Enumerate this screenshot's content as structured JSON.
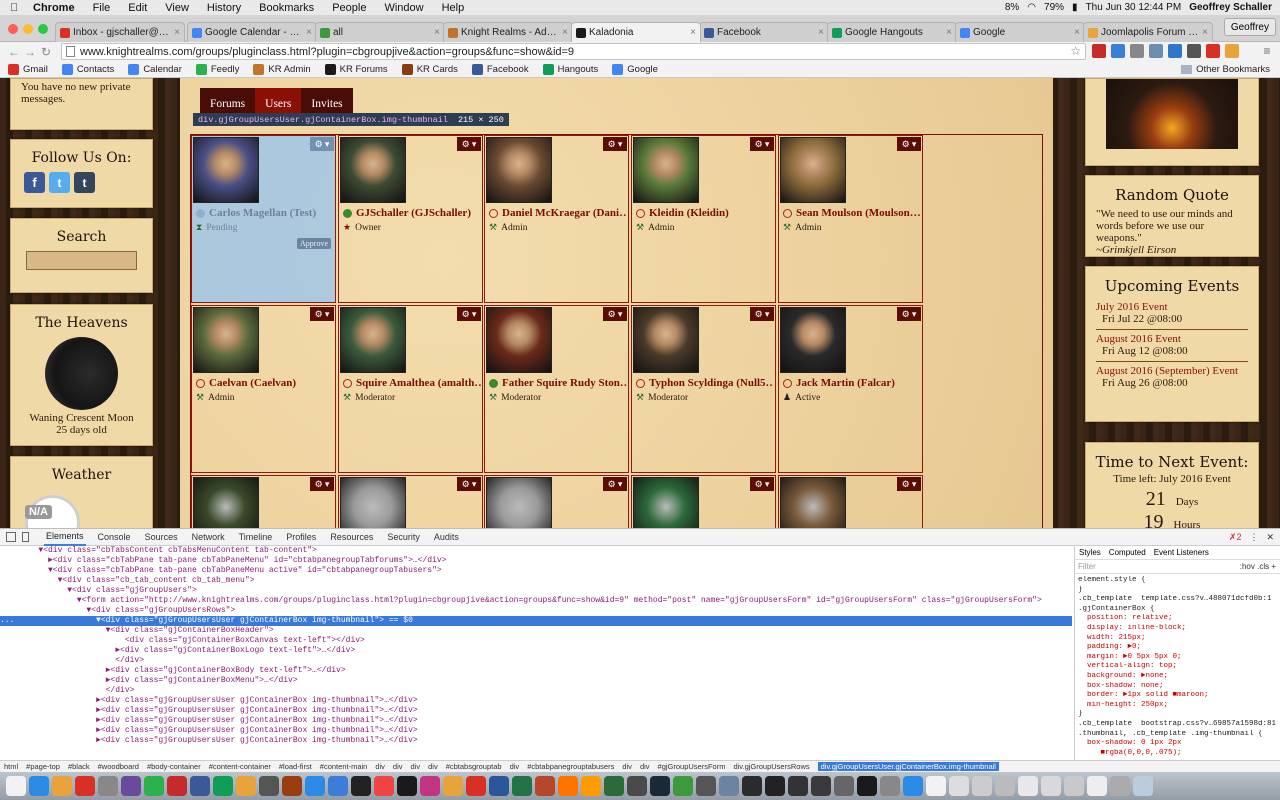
{
  "menubar": {
    "app": "Chrome",
    "items": [
      "File",
      "Edit",
      "View",
      "History",
      "Bookmarks",
      "People",
      "Window",
      "Help"
    ],
    "battery": "79%",
    "volume": "8%",
    "clock": "Thu Jun 30  12:44 PM",
    "user": "Geoffrey Schaller"
  },
  "tabs": [
    {
      "label": "Inbox - gjschaller@gmail.c",
      "color": "#d93025"
    },
    {
      "label": "Google Calendar - Month",
      "color": "#4285f4"
    },
    {
      "label": "all",
      "color": "#3b9a3b"
    },
    {
      "label": "Knight Realms - Administ",
      "color": "#c1732a"
    },
    {
      "label": "Kaladonia",
      "color": "#1a1a1a"
    },
    {
      "label": "Facebook",
      "color": "#3b5998"
    },
    {
      "label": "Google Hangouts",
      "color": "#0f9d58"
    },
    {
      "label": "Google",
      "color": "#4285f4"
    },
    {
      "label": "Joomlapolis Forum - Forum",
      "color": "#e8a33a"
    }
  ],
  "profile_button": "Geoffrey",
  "address": {
    "url": "www.knightrealms.com/groups/pluginclass.html?plugin=cbgroupjive&action=groups&func=show&id=9"
  },
  "bookmarks": [
    {
      "label": "Gmail",
      "color": "#d93025"
    },
    {
      "label": "Contacts",
      "color": "#4285f4"
    },
    {
      "label": "Calendar",
      "color": "#4285f4"
    },
    {
      "label": "Feedly",
      "color": "#2bb24c"
    },
    {
      "label": "KR Admin",
      "color": "#c1732a"
    },
    {
      "label": "KR Forums",
      "color": "#1a1a1a"
    },
    {
      "label": "KR Cards",
      "color": "#8a3b12"
    },
    {
      "label": "Facebook",
      "color": "#3b5998"
    },
    {
      "label": "Hangouts",
      "color": "#0f9d58"
    },
    {
      "label": "Google",
      "color": "#4285f4"
    }
  ],
  "other_bookmarks": "Other Bookmarks",
  "left": {
    "private_msg": "You have no new private messages.",
    "follow_title": "Follow Us On:",
    "search_title": "Search",
    "heavens_title": "The Heavens",
    "moon_phase": "Waning Crescent Moon",
    "moon_age": "25 days old",
    "weather_title": "Weather",
    "weather_badge": "N/A"
  },
  "group_tabs": [
    "Forums",
    "Users",
    "Invites"
  ],
  "tooltip": {
    "selector": "div.gjGroupUsersUser.gjContainerBox.img-thumbnail",
    "dims": "215 × 250"
  },
  "users": [
    {
      "name": "Carlos Magellan (Test)",
      "status": "pend",
      "role": "Pending",
      "role_icon": "hourglass-icon",
      "approve": "Approve",
      "avatar": "#4a4f86"
    },
    {
      "name": "GJSchaller (GJSchaller)",
      "status": "on",
      "role": "Owner",
      "role_icon": "star-icon",
      "avatar": "#3e4b33"
    },
    {
      "name": "Daniel McKraegar (Dani…",
      "status": "off",
      "role": "Admin",
      "role_icon": "hammer-icon",
      "avatar": "#6a4a33"
    },
    {
      "name": "Kleidin (Kleidin)",
      "status": "off",
      "role": "Admin",
      "role_icon": "hammer-icon",
      "avatar": "#5a7a3a"
    },
    {
      "name": "Sean Moulson (Moulson…",
      "status": "off",
      "role": "Admin",
      "role_icon": "hammer-icon",
      "avatar": "#8a6a3a"
    },
    {
      "name": "Caelvan (Caelvan)",
      "status": "off",
      "role": "Admin",
      "role_icon": "hammer-icon",
      "avatar": "#5b6a3c"
    },
    {
      "name": "Squire Amalthea (amalth…",
      "status": "off",
      "role": "Moderator",
      "role_icon": "hammer-icon",
      "avatar": "#3c5a3c"
    },
    {
      "name": "Father Squire Rudy Ston…",
      "status": "on",
      "role": "Moderator",
      "role_icon": "hammer-icon",
      "avatar": "#6a2a1a"
    },
    {
      "name": "Typhon Scyldinga (Null5…",
      "status": "off",
      "role": "Moderator",
      "role_icon": "hammer-icon",
      "avatar": "#4a3a2a"
    },
    {
      "name": "Jack Martin (Falcar)",
      "status": "off",
      "role": "Active",
      "role_icon": "user-icon",
      "avatar": "#2a2a2a"
    }
  ],
  "right": {
    "quote_title": "Random Quote",
    "quote_text": "\"We need to use our minds and words before we use our weapons.\"",
    "quote_author": "~Grimkjell Eirson",
    "events_title": "Upcoming Events",
    "events": [
      {
        "name": "July 2016 Event",
        "date": "Fri Jul 22 @08:00"
      },
      {
        "name": "August 2016 Event",
        "date": "Fri Aug 12 @08:00"
      },
      {
        "name": "August 2016 (September) Event",
        "date": "Fri Aug 26 @08:00"
      }
    ],
    "next_title": "Time to Next Event:",
    "time_left": "Time left: July 2016 Event",
    "days_num": "21",
    "days_label": "Days",
    "hours_num": "19",
    "hours_label": "Hours"
  },
  "devtools": {
    "tabs": [
      "Elements",
      "Console",
      "Sources",
      "Network",
      "Timeline",
      "Profiles",
      "Resources",
      "Security",
      "Audits"
    ],
    "errors": "2",
    "lines": [
      "        ▼<div class=\"cbTabsContent cbTabsMenuContent tab-content\">",
      "          ►<div class=\"cbTabPane tab-pane cbTabPaneMenu\" id=\"cbtabpanegroupTabforums\">…</div>",
      "          ▼<div class=\"cbTabPane tab-pane cbTabPaneMenu active\" id=\"cbtabpanegroupTabusers\">",
      "            ▼<div class=\"cb_tab_content cb_tab_menu\">",
      "              ▼<div class=\"gjGroupUsers\">",
      "                ▼<form action=\"http://www.knightrealms.com/groups/pluginclass.html?plugin=cbgroupjive&action=groups&func=show&id=9\" method=\"post\" name=\"gjGroupUsersForm\" id=\"gjGroupUsersForm\" class=\"gjGroupUsersForm\">",
      "                  ▼<div class=\"gjGroupUsersRows\">",
      "...                 ▼<div class=\"gjGroupUsersUser gjContainerBox img-thumbnail\"> == $0",
      "                      ▼<div class=\"gjContainerBoxHeader\">",
      "                          <div class=\"gjContainerBoxCanvas text-left\"></div>",
      "                        ►<div class=\"gjContainerBoxLogo text-left\">…</div>",
      "                        </div>",
      "                      ►<div class=\"gjContainerBoxBody text-left\">…</div>",
      "                      ►<div class=\"gjContainerBoxMenu\">…</div>",
      "                      </div>",
      "                    ►<div class=\"gjGroupUsersUser gjContainerBox img-thumbnail\">…</div>",
      "                    ►<div class=\"gjGroupUsersUser gjContainerBox img-thumbnail\">…</div>",
      "                    ►<div class=\"gjGroupUsersUser gjContainerBox img-thumbnail\">…</div>",
      "                    ►<div class=\"gjGroupUsersUser gjContainerBox img-thumbnail\">…</div>",
      "                    ►<div class=\"gjGroupUsersUser gjContainerBox img-thumbnail\">…</div>"
    ],
    "styles_tabs": [
      "Styles",
      "Computed",
      "Event Listeners"
    ],
    "filter": "Filter",
    "filter_opts": ":hov  .cls  +",
    "rules": [
      "element.style {",
      "}",
      ".cb_template  template.css?v…488071dcfd0b:1",
      ".gjContainerBox {",
      "  position: relative;",
      "  display: inline-block;",
      "  width: 215px;",
      "  padding: ►0;",
      "  margin: ►0 5px 5px 0;",
      "  vertical-align: top;",
      "  background: ►none;",
      "  box-shadow: none;",
      "  border: ►1px solid ■maroon;",
      "  min-height: 250px;",
      "}",
      ".cb_template  bootstrap.css?v…69857a1598d:81",
      ".thumbnail, .cb_template .img-thumbnail {",
      "  box-shadow: 0 1px 2px",
      "     ■rgba(0,0,0,.075);"
    ],
    "crumbs": [
      "html",
      "#page-top",
      "#black",
      "#woodboard",
      "#body-container",
      "#content-container",
      "#load-first",
      "#content-main",
      "div",
      "div",
      "div",
      "div",
      "#cbtabsgrouptab",
      "div",
      "#cbtabpanegrouptabusers",
      "div",
      "div",
      "#gjGroupUsersForm",
      "div.gjGroupUsersRows",
      "div.gjGroupUsersUser.gjContainerBox.img-thumbnail"
    ]
  }
}
